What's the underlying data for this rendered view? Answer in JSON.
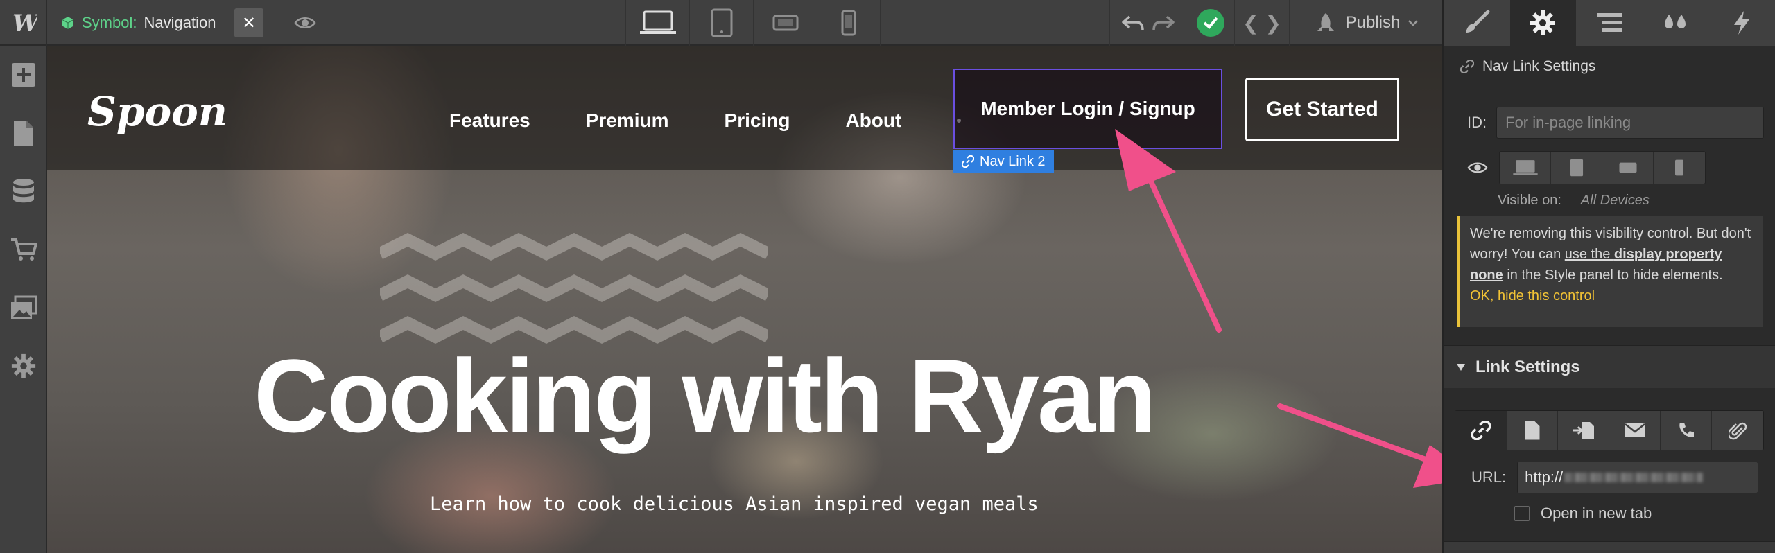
{
  "topbar": {
    "symbol_label": "Symbol:",
    "symbol_value": "Navigation",
    "close_glyph": "✕",
    "publish_label": "Publish",
    "code_glyph": "❮ ❯"
  },
  "left_sidebar": {
    "items": [
      "add-icon",
      "pages-icon",
      "cms-icon",
      "ecommerce-icon",
      "assets-icon",
      "settings-icon"
    ]
  },
  "panel_tabs": [
    "style-brush-icon",
    "settings-gear-icon",
    "navigator-icon",
    "style-manager-icon",
    "interactions-icon"
  ],
  "site": {
    "logo_text": "Spoon",
    "nav": {
      "items": [
        "Features",
        "Premium",
        "Pricing",
        "About"
      ],
      "member": "Member Login / Signup",
      "get_started": "Get Started"
    },
    "selected_tag": "Nav Link 2",
    "hero_title": "Cooking with Ryan",
    "hero_subtitle": "Learn how to cook delicious Asian inspired vegan meals"
  },
  "panel": {
    "section_title": "Nav Link Settings",
    "id_label": "ID:",
    "id_placeholder": "For in-page linking",
    "visible_on_label": "Visible on:",
    "visible_on_value": "All Devices",
    "warning": {
      "t1": "We're removing this visibility control. But don't worry! You can ",
      "u1": "use the ",
      "b1": "display property",
      "u2": " ",
      "b2": "none",
      "t2": " in the Style panel to hide elements.",
      "link": "OK, hide this control"
    },
    "link_settings_title": "Link Settings",
    "url_label": "URL:",
    "url_prefix": "http://",
    "new_tab_label": "Open in new tab"
  },
  "colors": {
    "accent_green": "#2fa85c",
    "selection_blue": "#2f7fe0",
    "annotation_pink": "#f0508a",
    "warning_yellow": "#e8c23a"
  }
}
